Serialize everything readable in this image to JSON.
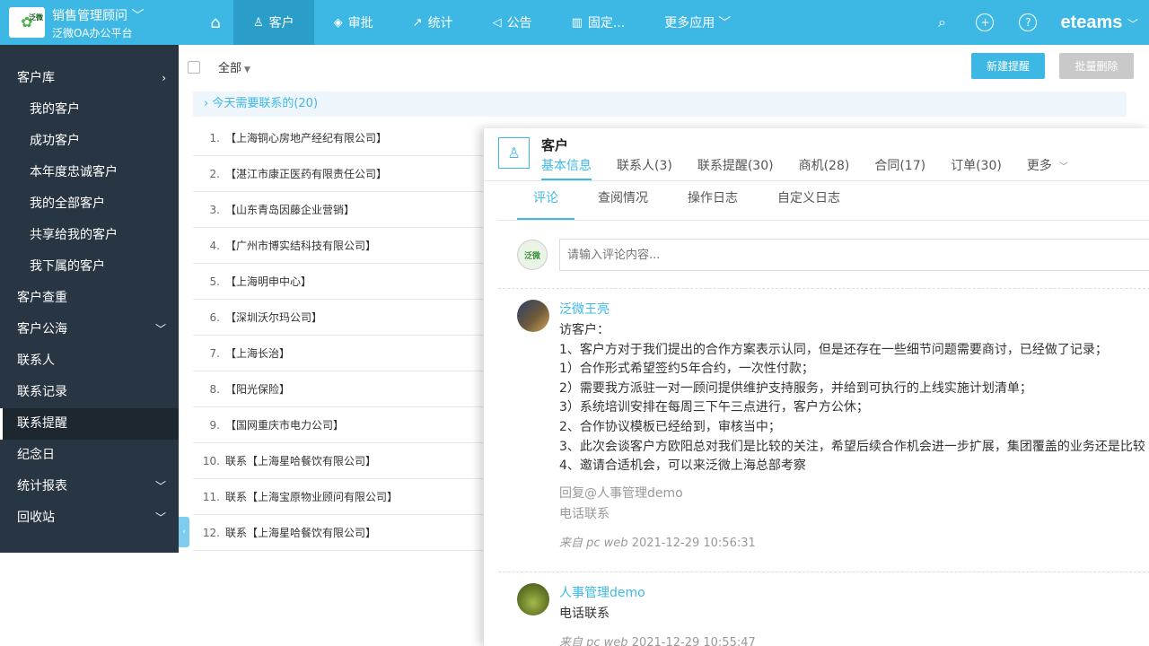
{
  "brand": {
    "title": "销售管理顾问",
    "subtitle": "泛微OA办公平台",
    "logo_text": "泛微",
    "title_caret": "﹀"
  },
  "nav": {
    "home_icon": "⌂",
    "items": [
      {
        "label": "客户",
        "icon": "person-icon",
        "glyph": "♙"
      },
      {
        "label": "审批",
        "icon": "layers-icon",
        "glyph": "◈"
      },
      {
        "label": "统计",
        "icon": "trend-icon",
        "glyph": "↗"
      },
      {
        "label": "公告",
        "icon": "speaker-icon",
        "glyph": "◁"
      },
      {
        "label": "固定...",
        "icon": "book-icon",
        "glyph": "▥"
      },
      {
        "label": "更多应用",
        "icon": "chevron-down-icon",
        "glyph": "﹀"
      }
    ],
    "active_index": 0
  },
  "top_right": {
    "search_glyph": "⌕",
    "add_glyph": "+",
    "help_glyph": "?",
    "product": "eteams",
    "product_caret": "﹀"
  },
  "sidebar": {
    "items": [
      {
        "label": "客户库",
        "arrow": "›",
        "sub": false
      },
      {
        "label": "我的客户",
        "sub": true
      },
      {
        "label": "成功客户",
        "sub": true
      },
      {
        "label": "本年度忠诚客户",
        "sub": true
      },
      {
        "label": "我的全部客户",
        "sub": true
      },
      {
        "label": "共享给我的客户",
        "sub": true
      },
      {
        "label": "我下属的客户",
        "sub": true
      },
      {
        "label": "客户查重",
        "sub": false
      },
      {
        "label": "客户公海",
        "arrow": "﹀",
        "sub": false
      },
      {
        "label": "联系人",
        "sub": false
      },
      {
        "label": "联系记录",
        "sub": false
      },
      {
        "label": "联系提醒",
        "sub": false,
        "active": true
      },
      {
        "label": "纪念日",
        "sub": false
      },
      {
        "label": "统计报表",
        "arrow": "﹀",
        "sub": false
      },
      {
        "label": "回收站",
        "arrow": "﹀",
        "sub": false
      }
    ],
    "collapse_glyph": "‹"
  },
  "toolbar": {
    "filter_label": "全部",
    "filter_caret": "▼",
    "new_button": "新建提醒",
    "delete_button": "批量删除"
  },
  "group": {
    "title": "今天需要联系的(20)",
    "chevron": "›"
  },
  "list": {
    "rows": [
      {
        "num": "1.",
        "text": "【上海铜心房地产经纪有限公司】"
      },
      {
        "num": "2.",
        "text": "【湛江市康正医药有限责任公司】"
      },
      {
        "num": "3.",
        "text": "【山东青岛因藤企业营销】"
      },
      {
        "num": "4.",
        "text": "【广州市博实结科技有限公司】"
      },
      {
        "num": "5.",
        "text": "【上海明申中心】"
      },
      {
        "num": "6.",
        "text": "【深圳沃尔玛公司】"
      },
      {
        "num": "7.",
        "text": "【上海长治】"
      },
      {
        "num": "8.",
        "text": "【阳光保险】"
      },
      {
        "num": "9.",
        "text": "【国网重庆市电力公司】"
      },
      {
        "num": "10.",
        "text": "联系【上海星哈餐饮有限公司】"
      },
      {
        "num": "11.",
        "text": "联系【上海宝原物业顾问有限公司】"
      },
      {
        "num": "12.",
        "text": "联系【上海星哈餐饮有限公司】"
      }
    ]
  },
  "panel": {
    "icon_glyph": "♙",
    "title": "客户",
    "tabs": [
      {
        "label": "基本信息",
        "active": true
      },
      {
        "label": "联系人(3)"
      },
      {
        "label": "联系提醒(30)"
      },
      {
        "label": "商机(28)"
      },
      {
        "label": "合同(17)"
      },
      {
        "label": "订单(30)"
      },
      {
        "label": "更多",
        "caret": "﹀"
      }
    ],
    "sub_tabs": [
      {
        "label": "评论",
        "active": true
      },
      {
        "label": "查阅情况"
      },
      {
        "label": "操作日志"
      },
      {
        "label": "自定义日志"
      }
    ],
    "comment_placeholder": "请输入评论内容...",
    "avatar_text": "泛微",
    "posts": [
      {
        "author": "泛微王亮",
        "lines": [
          "访客户：",
          "1、客户方对于我们提出的合作方案表示认同，但是还存在一些细节问题需要商讨，已经做了记录；",
          "1）合作形式希望签约5年合约，一次性付款；",
          "2）需要我方派驻一对一顾问提供维护支持服务，并给到可执行的上线实施计划清单；",
          "3）系统培训安排在每周三下午三点进行，客户方公休；",
          "2、合作协议模板已经给到，审核当中；",
          "3、此次会谈客户方欧阳总对我们是比较的关注，希望后续合作机会进一步扩展，集团覆盖的业务还是比较",
          "4、邀请合适机会，可以来泛微上海总部考察"
        ],
        "reply": "回复@人事管理demo",
        "tag": "电话联系",
        "source_from": "来自 pc web",
        "time": "2021-12-29 10:56:31"
      },
      {
        "author": "人事管理demo",
        "lines": [
          "电话联系"
        ],
        "source_from": "来自 pc web",
        "time": "2021-12-29 10:55:47"
      }
    ]
  }
}
